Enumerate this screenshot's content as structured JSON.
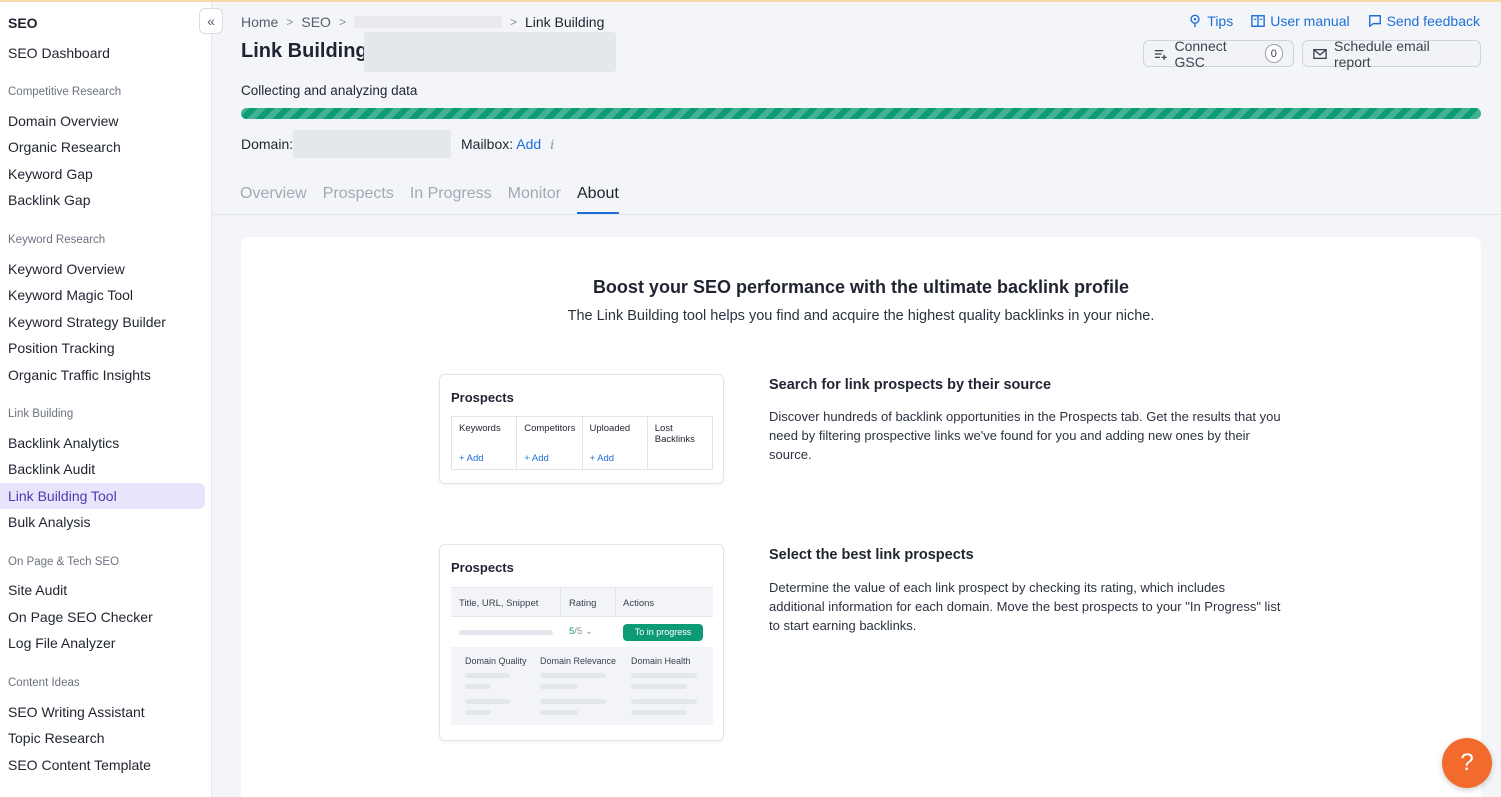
{
  "sidebar": {
    "title": "SEO",
    "collapse_icon": "«",
    "dashboard": "SEO Dashboard",
    "groups": {
      "competitive": "Competitive Research",
      "keyword": "Keyword Research",
      "link": "Link Building",
      "onpage": "On Page & Tech SEO",
      "content": "Content Ideas"
    },
    "items": {
      "domain_overview": "Domain Overview",
      "organic_research": "Organic Research",
      "keyword_gap": "Keyword Gap",
      "backlink_gap": "Backlink Gap",
      "keyword_overview": "Keyword Overview",
      "keyword_magic": "Keyword Magic Tool",
      "keyword_strategy": "Keyword Strategy Builder",
      "position_tracking": "Position Tracking",
      "organic_traffic": "Organic Traffic Insights",
      "backlink_analytics": "Backlink Analytics",
      "backlink_audit": "Backlink Audit",
      "link_building_tool": "Link Building Tool",
      "bulk_analysis": "Bulk Analysis",
      "site_audit": "Site Audit",
      "on_page_checker": "On Page SEO Checker",
      "log_file": "Log File Analyzer",
      "writing_assistant": "SEO Writing Assistant",
      "topic_research": "Topic Research",
      "content_template": "SEO Content Template"
    }
  },
  "header": {
    "breadcrumb": {
      "home": "Home",
      "seo": "SEO",
      "current": "Link Building"
    },
    "title": "Link Building:",
    "links": {
      "tips": "Tips",
      "manual": "User manual",
      "feedback": "Send feedback"
    },
    "connect_gsc": "Connect GSC",
    "gsc_count": "0",
    "schedule": "Schedule email report",
    "collecting": "Collecting and analyzing data",
    "progress": 1.0,
    "domain_label": "Domain:",
    "mailbox_label": "Mailbox:",
    "mailbox_add": "Add",
    "info_icon": "i"
  },
  "tabs": [
    "Overview",
    "Prospects",
    "In Progress",
    "Monitor",
    "About"
  ],
  "about": {
    "headline": "Boost your SEO performance with the ultimate backlink profile",
    "subline": "The Link Building tool helps you find and acquire the highest quality backlinks in your niche.",
    "illus1": {
      "title": "Prospects",
      "cols": [
        "Keywords",
        "Competitors",
        "Uploaded",
        "Lost Backlinks"
      ],
      "add": "+ Add"
    },
    "illus2": {
      "title": "Prospects",
      "cols": [
        "Title, URL, Snippet",
        "Rating",
        "Actions"
      ],
      "rating": "5",
      "rating_of": "/5",
      "button": "To in progress",
      "details": [
        "Domain Quality",
        "Domain Relevance",
        "Domain Health"
      ]
    },
    "feature1": {
      "title": "Search for link prospects by their source",
      "text": "Discover hundreds of backlink opportunities in the Prospects tab. Get the results that you need by filtering prospective links we've found for you and adding new ones by their source."
    },
    "feature2": {
      "title": "Select the best link prospects",
      "text": "Determine the value of each link prospect by checking its rating, which includes additional information for each domain. Move the best prospects to your \"In Progress\" list to start earning backlinks."
    }
  },
  "help_label": "?"
}
